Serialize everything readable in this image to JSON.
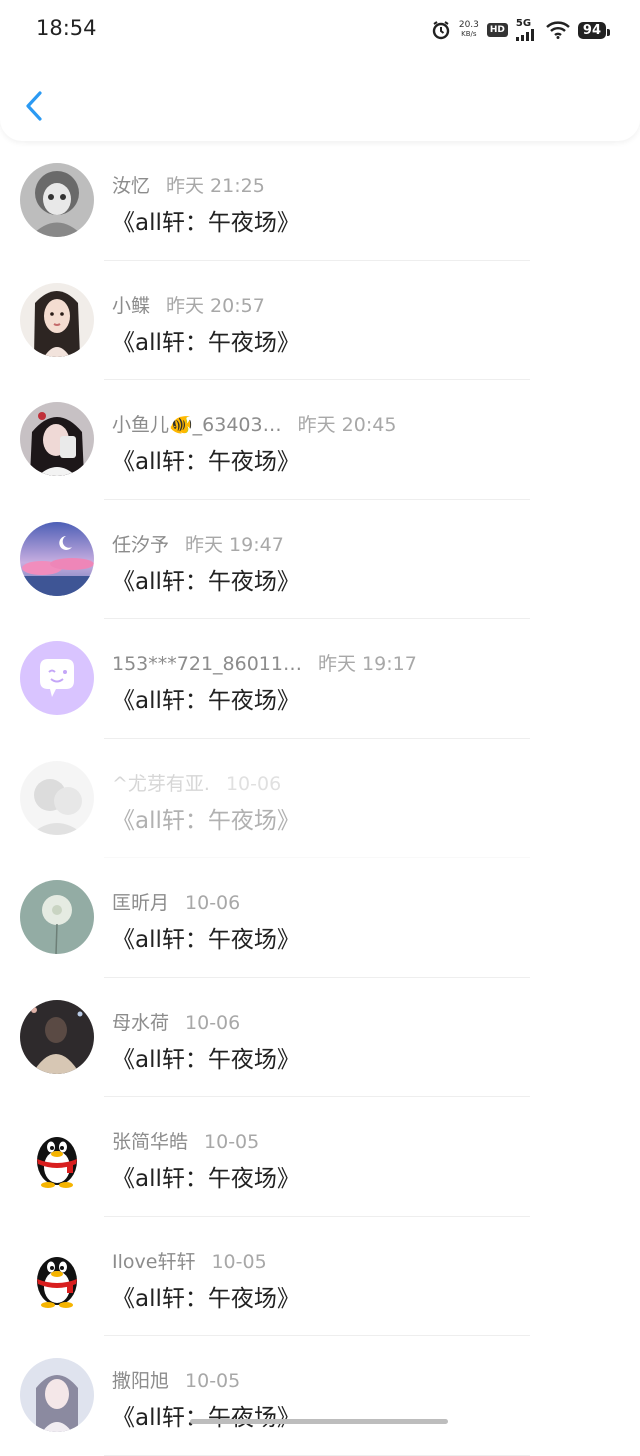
{
  "status_bar": {
    "time": "18:54",
    "net_speed": "20.3",
    "net_unit": "KB/s",
    "hd": "HD",
    "signal": "5G",
    "battery": "94"
  },
  "colors": {
    "accent": "#2b9af3",
    "name_gray": "#8c8c8c",
    "divider": "#eeeeee"
  },
  "messages": [
    {
      "name": "汝忆",
      "time": "昨天 21:25",
      "text": "《all轩：午夜场》",
      "avatar": "anime-girl-gray"
    },
    {
      "name": "小鲽",
      "time": "昨天 20:57",
      "text": "《all轩：午夜场》",
      "avatar": "girl-photo"
    },
    {
      "name": "小鱼儿🐠_63403…",
      "time": "昨天 20:45",
      "text": "《all轩：午夜场》",
      "avatar": "girl-selfie"
    },
    {
      "name": "任汐予",
      "time": "昨天 19:47",
      "text": "《all轩：午夜场》",
      "avatar": "pink-sky-moon"
    },
    {
      "name": "153***721_86011…",
      "time": "昨天 19:17",
      "text": "《all轩：午夜场》",
      "avatar": "purple-chat-bubble"
    },
    {
      "name": "^尤芽有亚.",
      "time": "10-06",
      "text": "《all轩：午夜场》",
      "avatar": "faded-photo"
    },
    {
      "name": "匡昕月",
      "time": "10-06",
      "text": "《all轩：午夜场》",
      "avatar": "dandelion"
    },
    {
      "name": "母水荷",
      "time": "10-06",
      "text": "《all轩：午夜场》",
      "avatar": "night-girl"
    },
    {
      "name": "张简华皓",
      "time": "10-05",
      "text": "《all轩：午夜场》",
      "avatar": "qq-penguin"
    },
    {
      "name": "Ilove轩轩",
      "time": "10-05",
      "text": "《all轩：午夜场》",
      "avatar": "qq-penguin"
    },
    {
      "name": "撒阳旭",
      "time": "10-05",
      "text": "《all轩：午夜场》",
      "avatar": "girl-pale"
    }
  ]
}
